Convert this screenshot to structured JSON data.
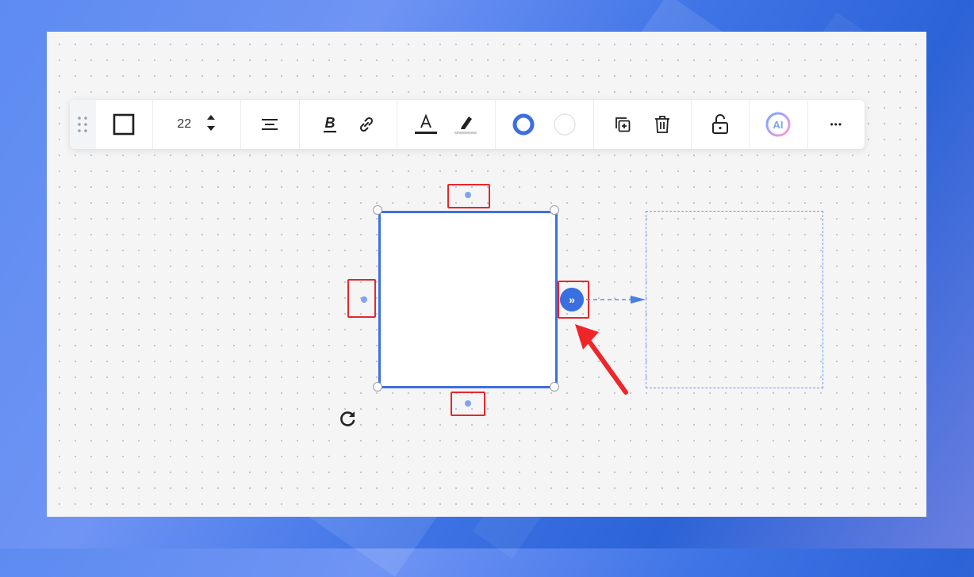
{
  "toolbar": {
    "font_size": "22",
    "ai_label": "AI",
    "more_label": "•••"
  },
  "connector": {
    "button_glyph": "»"
  },
  "icons": {
    "drag": "drag-dots-icon",
    "shape": "square-shape-icon",
    "stepper": "up-down-chevron-icon",
    "align": "align-center-icon",
    "bold": "bold-icon",
    "link": "link-icon",
    "text_color": "text-color-icon",
    "highlight": "highlighter-icon",
    "border_color": "blue-ring-icon",
    "fill_color": "white-circle-icon",
    "duplicate": "duplicate-icon",
    "delete": "trash-icon",
    "lock": "unlock-icon",
    "ai": "ai-icon",
    "more": "more-dots-icon",
    "rotate": "rotate-icon",
    "arrow": "red-arrow-pointer-icon"
  },
  "colors": {
    "accent": "#3e6fe0",
    "highlight_red": "#e8262b",
    "canvas_bg": "#f5f5f6",
    "text_color_bar": "#222222"
  }
}
